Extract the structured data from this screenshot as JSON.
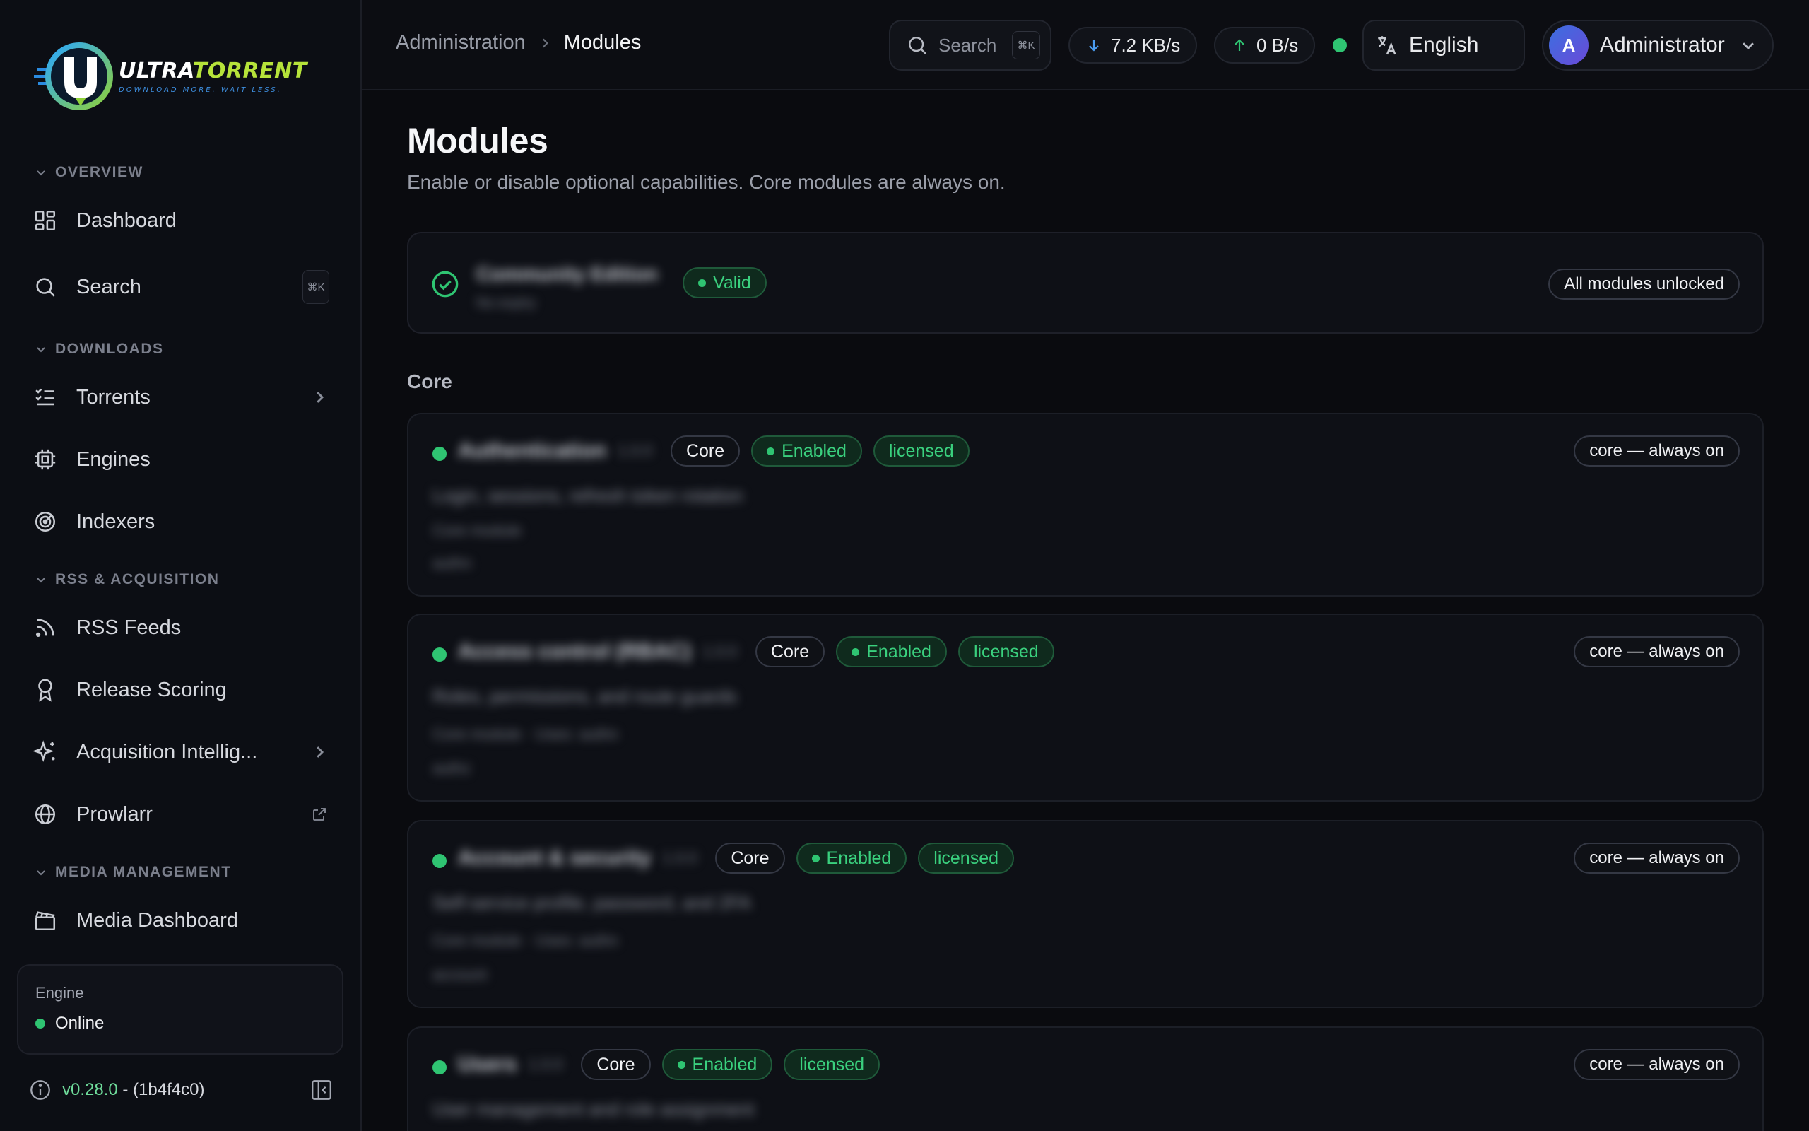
{
  "brand": {
    "name_a": "ULTRA",
    "name_b": "TORRENT",
    "tagline": "DOWNLOAD MORE. WAIT LESS."
  },
  "sidebar": {
    "sections": [
      {
        "label": "OVERVIEW"
      },
      {
        "label": "DOWNLOADS"
      },
      {
        "label": "RSS & ACQUISITION"
      },
      {
        "label": "MEDIA MANAGEMENT"
      }
    ],
    "items": [
      {
        "label": "Dashboard",
        "icon": "dashboard-grid-icon"
      },
      {
        "label": "Search",
        "icon": "search-icon",
        "shortcut": "⌘K"
      },
      {
        "label": "Torrents",
        "icon": "list-checks-icon"
      },
      {
        "label": "Engines",
        "icon": "cpu-chip-icon"
      },
      {
        "label": "Indexers",
        "icon": "radar-icon"
      },
      {
        "label": "RSS Feeds",
        "icon": "rss-icon"
      },
      {
        "label": "Release Scoring",
        "icon": "award-ribbon-icon"
      },
      {
        "label": "Acquisition Intellig...",
        "icon": "sparkles-icon"
      },
      {
        "label": "Prowlarr",
        "icon": "globe-icon"
      },
      {
        "label": "Media Dashboard",
        "icon": "clapperboard-icon"
      }
    ],
    "engine": {
      "title": "Engine",
      "status": "Online"
    },
    "version": {
      "number": "v0.28.0",
      "separator": " - ",
      "build": "(1b4f4c0)"
    }
  },
  "topbar": {
    "breadcrumb": {
      "parent": "Administration",
      "current": "Modules"
    },
    "search": {
      "label": "Search",
      "shortcut": "⌘K"
    },
    "download_rate": "7.2 KB/s",
    "upload_rate": "0 B/s",
    "language": "English",
    "user": {
      "initial": "A",
      "name": "Administrator"
    }
  },
  "page": {
    "title": "Modules",
    "subtitle": "Enable or disable optional capabilities. Core modules are always on."
  },
  "license": {
    "name": "Community Edition",
    "detail": "No expiry",
    "status": "Valid",
    "summary": "All modules unlocked"
  },
  "section_core": "Core",
  "modules": [
    {
      "name": "Authentication",
      "version": "1.0.0",
      "type": "Core",
      "state": "Enabled",
      "license": "licensed",
      "lock": "core — always on",
      "description": "Login, sessions, refresh token rotation",
      "meta": "Core module",
      "extra": "authn"
    },
    {
      "name": "Access control (RBAC)",
      "version": "1.0.0",
      "type": "Core",
      "state": "Enabled",
      "license": "licensed",
      "lock": "core — always on",
      "description": "Roles, permissions, and route guards",
      "meta": "Core module · Uses: authn",
      "extra": "authz"
    },
    {
      "name": "Account & security",
      "version": "1.0.0",
      "type": "Core",
      "state": "Enabled",
      "license": "licensed",
      "lock": "core — always on",
      "description": "Self-service profile, password, and 2FA",
      "meta": "Core module · Uses: authn",
      "extra": "account"
    },
    {
      "name": "Users",
      "version": "1.0.0",
      "type": "Core",
      "state": "Enabled",
      "license": "licensed",
      "lock": "core — always on",
      "description": "User management and role assignment",
      "meta": "",
      "extra": ""
    }
  ],
  "colors": {
    "accent_green": "#2fc472",
    "background": "#0a0b0f"
  }
}
